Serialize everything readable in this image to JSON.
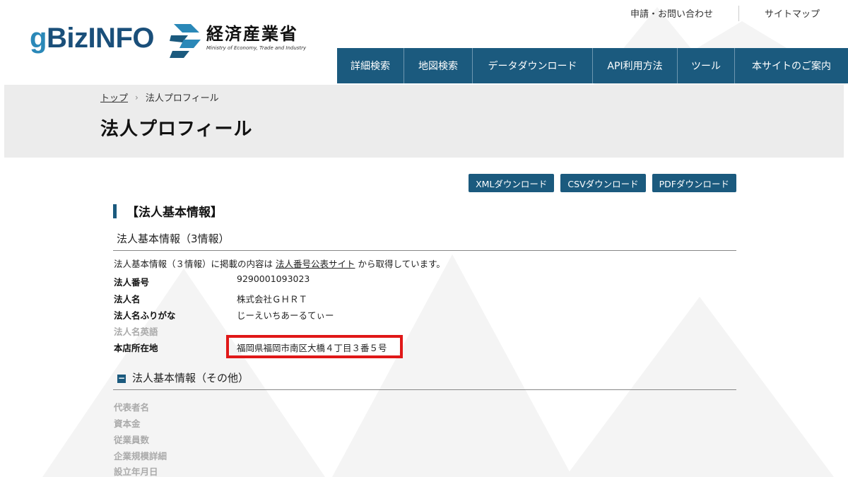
{
  "header": {
    "logo": {
      "prefix": "g",
      "rest": "BizINFO"
    },
    "meti": {
      "name_jp": "経済産業省",
      "name_en": "Ministry of Economy, Trade and Industry"
    },
    "util_links": [
      "申請・お問い合わせ",
      "サイトマップ"
    ],
    "nav": [
      "詳細検索",
      "地図検索",
      "データダウンロード",
      "API利用方法",
      "ツール",
      "本サイトのご案内"
    ]
  },
  "breadcrumb": {
    "home": "トップ",
    "current": "法人プロフィール"
  },
  "page_title": "法人プロフィール",
  "downloads": [
    "XMLダウンロード",
    "CSVダウンロード",
    "PDFダウンロード"
  ],
  "section": {
    "title": "【法人基本情報】",
    "sub_title": "法人基本情報（3情報）",
    "note": {
      "prefix": "法人基本情報（３情報）に掲載の内容は ",
      "link": "法人番号公表サイト",
      "suffix": " から取得しています。"
    },
    "rows": [
      {
        "label": "法人番号",
        "value": "9290001093023"
      },
      {
        "label": "法人名",
        "value": "株式会社ＧＨＲＴ"
      },
      {
        "label": "法人名ふりがな",
        "value": "じーえいちあーるてぃー"
      },
      {
        "label": "法人名英語",
        "value": ""
      },
      {
        "label": "本店所在地",
        "value": "福岡県福岡市南区大橋４丁目３番５号"
      }
    ],
    "other_title": "法人基本情報（その他）",
    "other_rows": [
      "代表者名",
      "資本金",
      "従業員数",
      "企業規模詳細",
      "設立年月日"
    ]
  },
  "colors": {
    "accent": "#1b5a7e",
    "highlight": "#e01818",
    "band": "#ececec"
  }
}
